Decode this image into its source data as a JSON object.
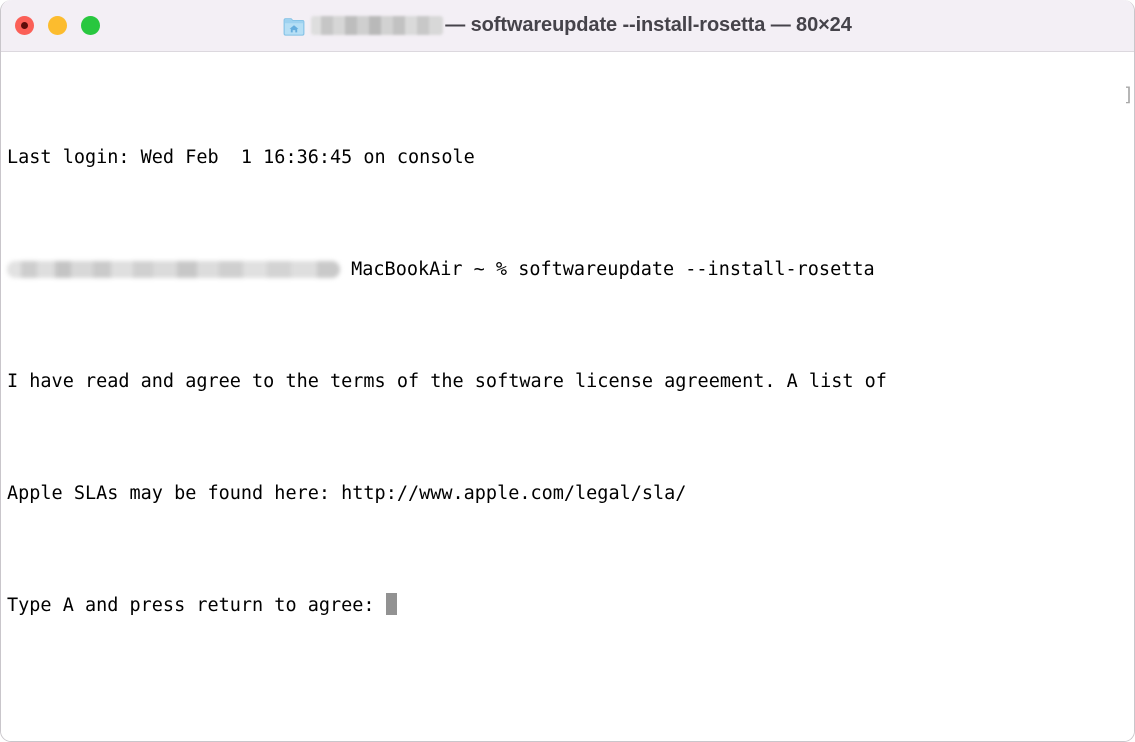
{
  "window": {
    "title_prefix_redacted": true,
    "title_text": "— softwareupdate --install-rosetta — 80×24",
    "folder_icon": "home-folder-icon",
    "traffic_lights": [
      {
        "name": "close",
        "label": "Close",
        "color": "#fb5f57",
        "has_dot": true
      },
      {
        "name": "minimize",
        "label": "Minimize",
        "color": "#fcbc2e",
        "has_dot": false
      },
      {
        "name": "zoom",
        "label": "Zoom",
        "color": "#28c73f",
        "has_dot": false
      }
    ],
    "titlebar_bg": "#f3eff5",
    "body_bg": "#ffffff",
    "columns": 80,
    "rows": 24
  },
  "terminal": {
    "line1": "Last login: Wed Feb  1 16:36:45 on console",
    "line2_after_redaction": " MacBookAir ~ % softwareupdate --install-rosetta",
    "line3": "I have read and agree to the terms of the software license agreement. A list of",
    "line4": "Apple SLAs may be found here: http://www.apple.com/legal/sla/",
    "line5": "Type A and press return to agree: ",
    "right_edge_glyph": "]",
    "cursor": {
      "shape": "block",
      "color": "#929292"
    },
    "text_color": "#000000",
    "prompt_symbol": "%",
    "hostname_suffix": "MacBookAir",
    "working_directory": "~",
    "command": "softwareupdate --install-rosetta",
    "url": "http://www.apple.com/legal/sla/"
  }
}
